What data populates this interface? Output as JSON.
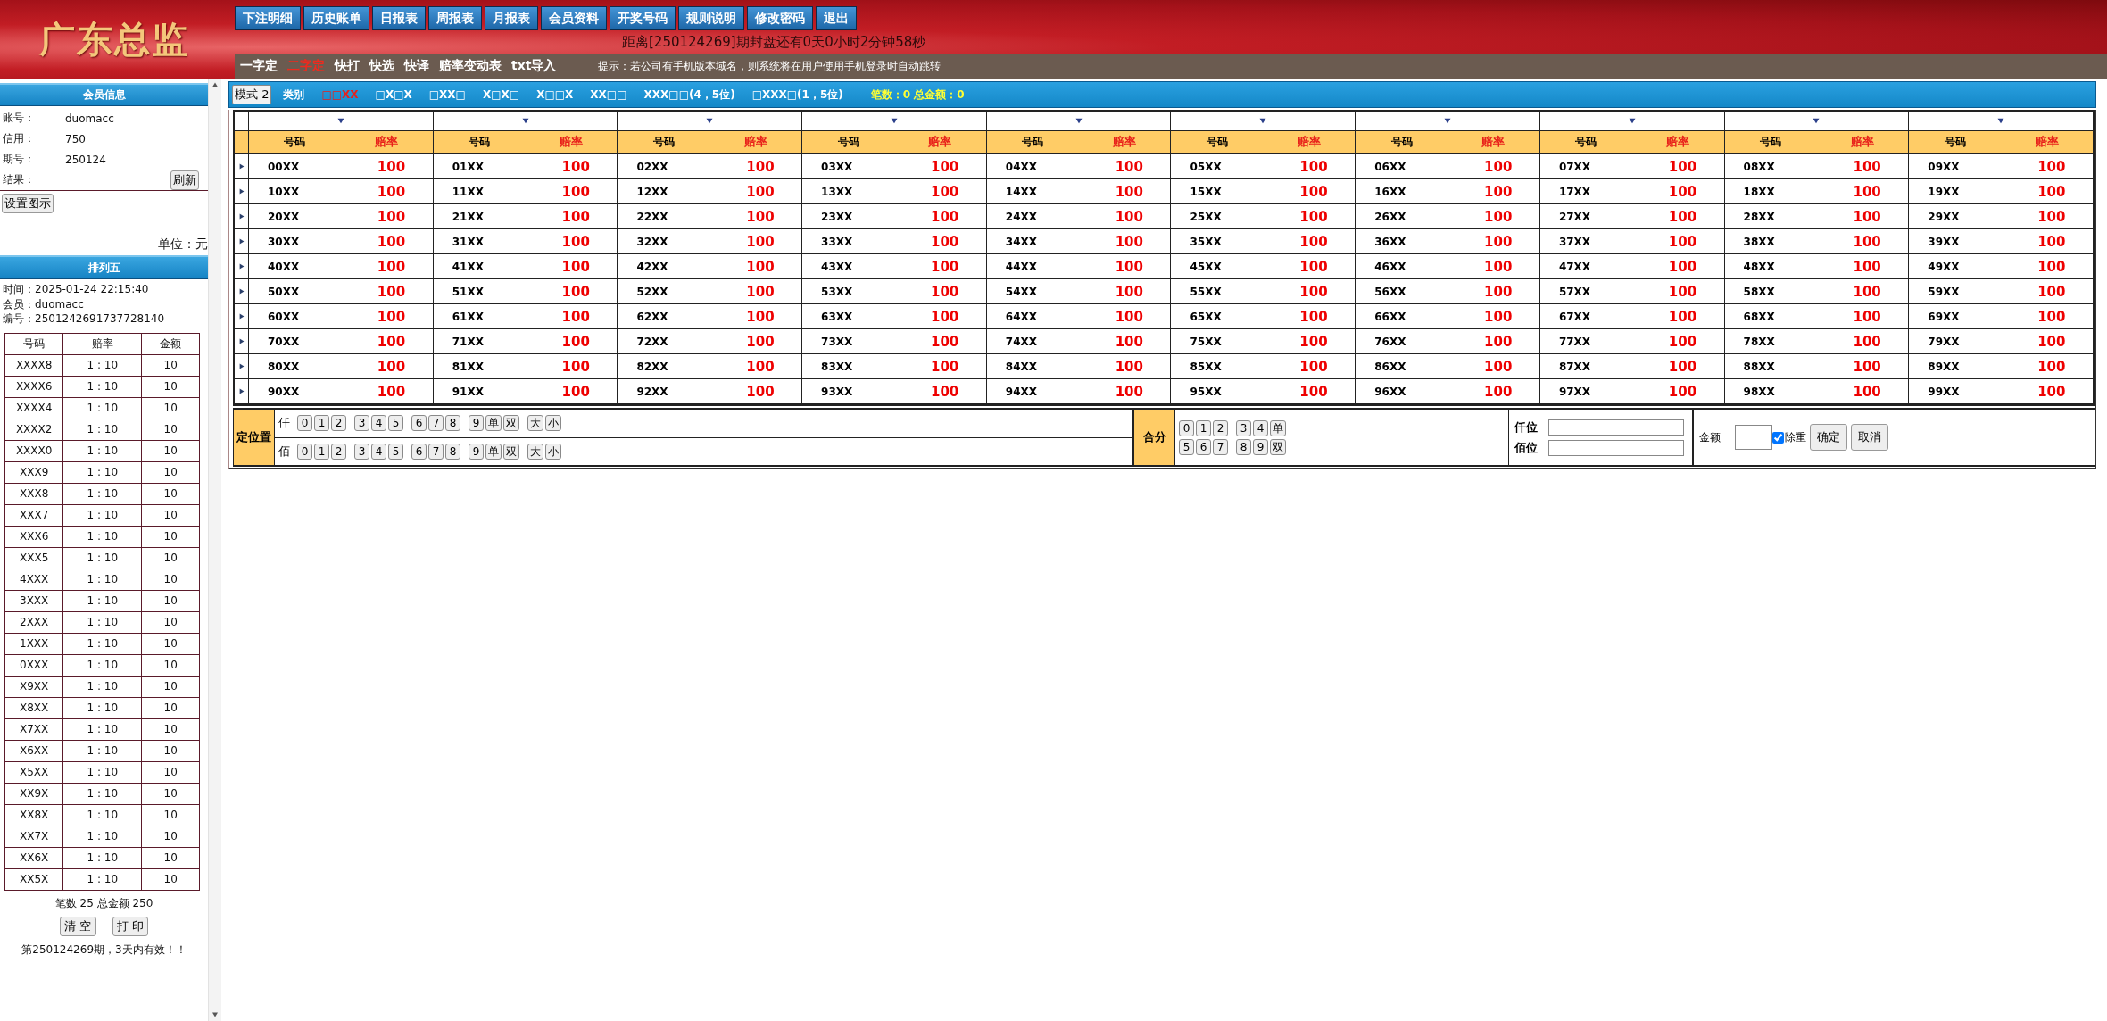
{
  "header": {
    "title": "广东总监",
    "nav": [
      "下注明细",
      "历史账单",
      "日报表",
      "周报表",
      "月报表",
      "会员资料",
      "开奖号码",
      "规则说明",
      "修改密码",
      "退出"
    ],
    "countdown": "距离[250124269]期封盘还有0天0小时2分钟58秒"
  },
  "submenu": {
    "tabs": [
      {
        "label": "一字定",
        "selected": false
      },
      {
        "label": "二字定",
        "selected": true
      },
      {
        "label": "快打",
        "selected": false
      },
      {
        "label": "快选",
        "selected": false
      },
      {
        "label": "快译",
        "selected": false
      },
      {
        "label": "赔率变动表",
        "selected": false
      },
      {
        "label": "txt导入",
        "selected": false
      }
    ],
    "hint": "提示：若公司有手机版本域名，则系统将在用户使用手机登录时自动跳转"
  },
  "member_info": {
    "title": "会员信息",
    "fields": [
      {
        "label": "账号：",
        "value": "duomacc"
      },
      {
        "label": "信用：",
        "value": "750"
      },
      {
        "label": "期号：",
        "value": "250124"
      },
      {
        "label": "结果："
      }
    ],
    "refresh_button": "刷新",
    "legend_button": "设置图示",
    "unit": "单位：元"
  },
  "ticket": {
    "title": "排列五",
    "lines": [
      "时间：2025-01-24 22:15:40",
      "会员：duomacc",
      "编号：2501242691737728140"
    ],
    "columns": [
      "号码",
      "赔率",
      "金额"
    ],
    "rows": [
      [
        "XXXX8",
        "1 : 10",
        "10"
      ],
      [
        "XXXX6",
        "1 : 10",
        "10"
      ],
      [
        "XXXX4",
        "1 : 10",
        "10"
      ],
      [
        "XXXX2",
        "1 : 10",
        "10"
      ],
      [
        "XXXX0",
        "1 : 10",
        "10"
      ],
      [
        "XXX9",
        "1 : 10",
        "10"
      ],
      [
        "XXX8",
        "1 : 10",
        "10"
      ],
      [
        "XXX7",
        "1 : 10",
        "10"
      ],
      [
        "XXX6",
        "1 : 10",
        "10"
      ],
      [
        "XXX5",
        "1 : 10",
        "10"
      ],
      [
        "4XXX",
        "1 : 10",
        "10"
      ],
      [
        "3XXX",
        "1 : 10",
        "10"
      ],
      [
        "2XXX",
        "1 : 10",
        "10"
      ],
      [
        "1XXX",
        "1 : 10",
        "10"
      ],
      [
        "0XXX",
        "1 : 10",
        "10"
      ],
      [
        "X9XX",
        "1 : 10",
        "10"
      ],
      [
        "X8XX",
        "1 : 10",
        "10"
      ],
      [
        "X7XX",
        "1 : 10",
        "10"
      ],
      [
        "X6XX",
        "1 : 10",
        "10"
      ],
      [
        "X5XX",
        "1 : 10",
        "10"
      ],
      [
        "XX9X",
        "1 : 10",
        "10"
      ],
      [
        "XX8X",
        "1 : 10",
        "10"
      ],
      [
        "XX7X",
        "1 : 10",
        "10"
      ],
      [
        "XX6X",
        "1 : 10",
        "10"
      ],
      [
        "XX5X",
        "1 : 10",
        "10"
      ]
    ],
    "summary": "笔数 25 总金额 250",
    "buttons": [
      "清 空",
      "打 印"
    ],
    "note": "第250124269期，3天内有效！！"
  },
  "board": {
    "mode_button": "模式 2",
    "category_label": "类别",
    "categories": [
      {
        "label": "□□XX",
        "selected": true
      },
      {
        "label": "□X□X",
        "selected": false
      },
      {
        "label": "□XX□",
        "selected": false
      },
      {
        "label": "X□X□",
        "selected": false
      },
      {
        "label": "X□□X",
        "selected": false
      },
      {
        "label": "XX□□",
        "selected": false
      },
      {
        "label": "XXX□□(4，5位)",
        "selected": false
      },
      {
        "label": "□XXX□(1，5位)",
        "selected": false
      }
    ],
    "totals": "笔数：0 总金额：0",
    "column_headers": [
      {
        "code": "号码",
        "odds": "赔率"
      },
      {
        "code": "号码",
        "odds": "赔率"
      },
      {
        "code": "号码",
        "odds": "赔率"
      },
      {
        "code": "号码",
        "odds": "赔率"
      },
      {
        "code": "号码",
        "odds": "赔率"
      },
      {
        "code": "号码",
        "odds": "赔率"
      },
      {
        "code": "号码",
        "odds": "赔率"
      },
      {
        "code": "号码",
        "odds": "赔率"
      },
      {
        "code": "号码",
        "odds": "赔率"
      },
      {
        "code": "号码",
        "odds": "赔率"
      }
    ],
    "rows": [
      [
        [
          "00XX",
          "100"
        ],
        [
          "01XX",
          "100"
        ],
        [
          "02XX",
          "100"
        ],
        [
          "03XX",
          "100"
        ],
        [
          "04XX",
          "100"
        ],
        [
          "05XX",
          "100"
        ],
        [
          "06XX",
          "100"
        ],
        [
          "07XX",
          "100"
        ],
        [
          "08XX",
          "100"
        ],
        [
          "09XX",
          "100"
        ]
      ],
      [
        [
          "10XX",
          "100"
        ],
        [
          "11XX",
          "100"
        ],
        [
          "12XX",
          "100"
        ],
        [
          "13XX",
          "100"
        ],
        [
          "14XX",
          "100"
        ],
        [
          "15XX",
          "100"
        ],
        [
          "16XX",
          "100"
        ],
        [
          "17XX",
          "100"
        ],
        [
          "18XX",
          "100"
        ],
        [
          "19XX",
          "100"
        ]
      ],
      [
        [
          "20XX",
          "100"
        ],
        [
          "21XX",
          "100"
        ],
        [
          "22XX",
          "100"
        ],
        [
          "23XX",
          "100"
        ],
        [
          "24XX",
          "100"
        ],
        [
          "25XX",
          "100"
        ],
        [
          "26XX",
          "100"
        ],
        [
          "27XX",
          "100"
        ],
        [
          "28XX",
          "100"
        ],
        [
          "29XX",
          "100"
        ]
      ],
      [
        [
          "30XX",
          "100"
        ],
        [
          "31XX",
          "100"
        ],
        [
          "32XX",
          "100"
        ],
        [
          "33XX",
          "100"
        ],
        [
          "34XX",
          "100"
        ],
        [
          "35XX",
          "100"
        ],
        [
          "36XX",
          "100"
        ],
        [
          "37XX",
          "100"
        ],
        [
          "38XX",
          "100"
        ],
        [
          "39XX",
          "100"
        ]
      ],
      [
        [
          "40XX",
          "100"
        ],
        [
          "41XX",
          "100"
        ],
        [
          "42XX",
          "100"
        ],
        [
          "43XX",
          "100"
        ],
        [
          "44XX",
          "100"
        ],
        [
          "45XX",
          "100"
        ],
        [
          "46XX",
          "100"
        ],
        [
          "47XX",
          "100"
        ],
        [
          "48XX",
          "100"
        ],
        [
          "49XX",
          "100"
        ]
      ],
      [
        [
          "50XX",
          "100"
        ],
        [
          "51XX",
          "100"
        ],
        [
          "52XX",
          "100"
        ],
        [
          "53XX",
          "100"
        ],
        [
          "54XX",
          "100"
        ],
        [
          "55XX",
          "100"
        ],
        [
          "56XX",
          "100"
        ],
        [
          "57XX",
          "100"
        ],
        [
          "58XX",
          "100"
        ],
        [
          "59XX",
          "100"
        ]
      ],
      [
        [
          "60XX",
          "100"
        ],
        [
          "61XX",
          "100"
        ],
        [
          "62XX",
          "100"
        ],
        [
          "63XX",
          "100"
        ],
        [
          "64XX",
          "100"
        ],
        [
          "65XX",
          "100"
        ],
        [
          "66XX",
          "100"
        ],
        [
          "67XX",
          "100"
        ],
        [
          "68XX",
          "100"
        ],
        [
          "69XX",
          "100"
        ]
      ],
      [
        [
          "70XX",
          "100"
        ],
        [
          "71XX",
          "100"
        ],
        [
          "72XX",
          "100"
        ],
        [
          "73XX",
          "100"
        ],
        [
          "74XX",
          "100"
        ],
        [
          "75XX",
          "100"
        ],
        [
          "76XX",
          "100"
        ],
        [
          "77XX",
          "100"
        ],
        [
          "78XX",
          "100"
        ],
        [
          "79XX",
          "100"
        ]
      ],
      [
        [
          "80XX",
          "100"
        ],
        [
          "81XX",
          "100"
        ],
        [
          "82XX",
          "100"
        ],
        [
          "83XX",
          "100"
        ],
        [
          "84XX",
          "100"
        ],
        [
          "85XX",
          "100"
        ],
        [
          "86XX",
          "100"
        ],
        [
          "87XX",
          "100"
        ],
        [
          "88XX",
          "100"
        ],
        [
          "89XX",
          "100"
        ]
      ],
      [
        [
          "90XX",
          "100"
        ],
        [
          "91XX",
          "100"
        ],
        [
          "92XX",
          "100"
        ],
        [
          "93XX",
          "100"
        ],
        [
          "94XX",
          "100"
        ],
        [
          "95XX",
          "100"
        ],
        [
          "96XX",
          "100"
        ],
        [
          "97XX",
          "100"
        ],
        [
          "98XX",
          "100"
        ],
        [
          "99XX",
          "100"
        ]
      ]
    ]
  },
  "controls": {
    "position": {
      "label": "定位置",
      "rows": [
        {
          "label": "仟",
          "groups": [
            [
              "0",
              "1",
              "2"
            ],
            [
              "3",
              "4",
              "5"
            ],
            [
              "6",
              "7",
              "8"
            ],
            [
              "9",
              "单",
              "双"
            ],
            [
              "大",
              "小"
            ]
          ]
        },
        {
          "label": "佰",
          "groups": [
            [
              "0",
              "1",
              "2"
            ],
            [
              "3",
              "4",
              "5"
            ],
            [
              "6",
              "7",
              "8"
            ],
            [
              "9",
              "单",
              "双"
            ],
            [
              "大",
              "小"
            ]
          ]
        }
      ]
    },
    "sum": {
      "label": "合分",
      "rows": [
        [
          [
            "0",
            "1",
            "2"
          ],
          [
            "3",
            "4",
            "单"
          ]
        ],
        [
          [
            "5",
            "6",
            "7"
          ],
          [
            "8",
            "9",
            "双"
          ]
        ]
      ]
    },
    "digit_fields": [
      {
        "label": "仟位"
      },
      {
        "label": "佰位"
      }
    ],
    "amount": {
      "label": "金额",
      "dedupe": {
        "label": "除重",
        "checked": true
      },
      "buttons": [
        "确定",
        "取消"
      ]
    }
  }
}
